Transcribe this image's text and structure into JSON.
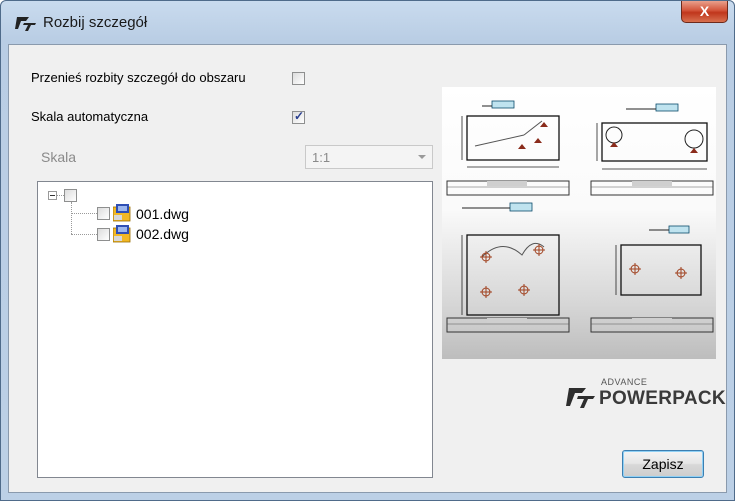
{
  "window": {
    "title": "Rozbij szczegół",
    "close_label": "X"
  },
  "options": {
    "explode_to_area_label": "Przenieś rozbity szczegół do obszaru",
    "explode_to_area_checked": false,
    "auto_scale_label": "Skala automatyczna",
    "auto_scale_checked": true,
    "scale_label": "Skala",
    "scale_value": "1:1"
  },
  "tree": {
    "root_checked": false,
    "items": [
      {
        "name": "001.dwg",
        "checked": false
      },
      {
        "name": "002.dwg",
        "checked": false
      }
    ]
  },
  "brand": {
    "advance": "ADVANCE",
    "powerpack": "POWERPACK"
  },
  "buttons": {
    "save_label": "Zapisz"
  },
  "icons": {
    "title": "gt-logo-icon",
    "file": "dwg-file-icon",
    "expander": "tree-expander-minus-icon",
    "close": "close-icon",
    "dropdown": "chevron-down-icon"
  },
  "colors": {
    "close_button": "#c0361c",
    "title_bar": "#c9dbee",
    "checkmark": "#2a3f8f"
  }
}
